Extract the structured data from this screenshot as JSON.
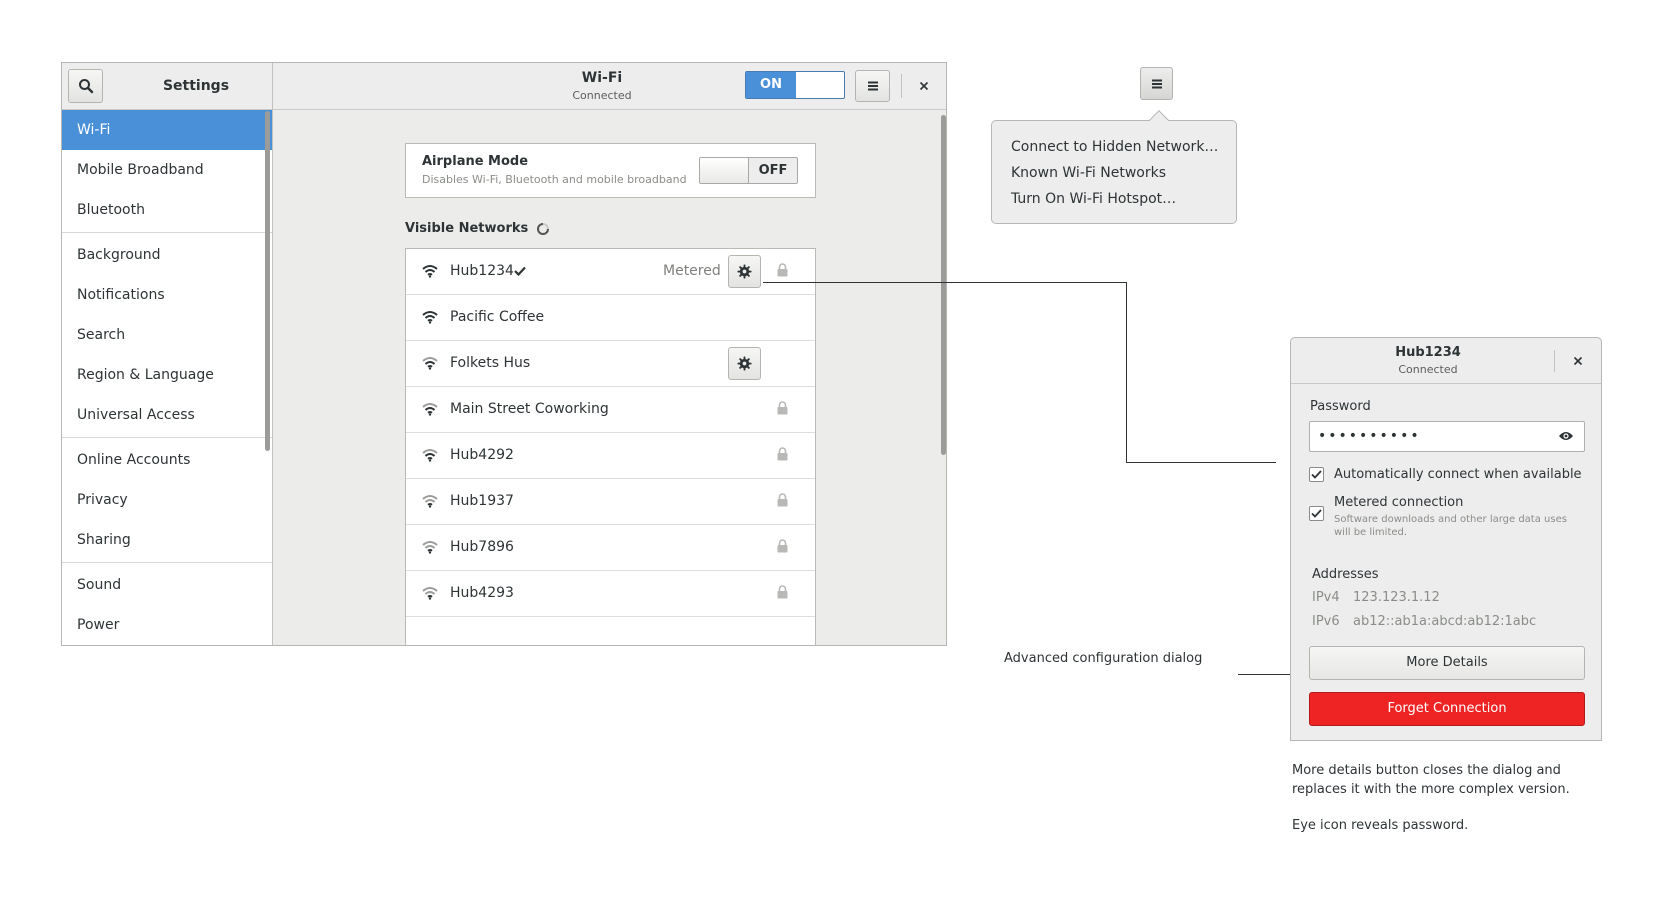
{
  "sidebar": {
    "title": "Settings",
    "items": [
      {
        "label": "Wi-Fi",
        "active": true
      },
      {
        "label": "Mobile Broadband"
      },
      {
        "label": "Bluetooth"
      },
      {
        "label": "Background"
      },
      {
        "label": "Notifications"
      },
      {
        "label": "Search"
      },
      {
        "label": "Region & Language"
      },
      {
        "label": "Universal Access"
      },
      {
        "label": "Online Accounts"
      },
      {
        "label": "Privacy"
      },
      {
        "label": "Sharing"
      },
      {
        "label": "Sound"
      },
      {
        "label": "Power"
      }
    ]
  },
  "header": {
    "title": "Wi-Fi",
    "subtitle": "Connected",
    "wifi_switch": "ON"
  },
  "airplane": {
    "title": "Airplane Mode",
    "subtitle": "Disables Wi-Fi, Bluetooth and mobile broadband",
    "switch": "OFF"
  },
  "visible_networks": {
    "title": "Visible Networks",
    "networks": [
      {
        "name": "Hub1234",
        "connected": true,
        "metered": "Metered",
        "settings": true,
        "locked": true
      },
      {
        "name": "Pacific Coffee"
      },
      {
        "name": "Folkets Hus",
        "settings": true
      },
      {
        "name": "Main Street Coworking",
        "locked": true
      },
      {
        "name": "Hub4292",
        "locked": true
      },
      {
        "name": "Hub1937",
        "locked": true
      },
      {
        "name": "Hub7896",
        "locked": true
      },
      {
        "name": "Hub4293",
        "locked": true
      }
    ]
  },
  "popover_menu": {
    "items": [
      "Connect to Hidden Network…",
      "Known Wi-Fi Networks",
      "Turn On Wi-Fi Hotspot…"
    ]
  },
  "dialog": {
    "title": "Hub1234",
    "subtitle": "Connected",
    "password_label": "Password",
    "password_value": "••••••••••",
    "auto_connect": "Automatically connect when available",
    "metered": "Metered connection",
    "metered_sub": "Software downloads and other large data uses will be limited.",
    "addresses_title": "Addresses",
    "ipv4_label": "IPv4",
    "ipv4_value": "123.123.1.12",
    "ipv6_label": "IPv6",
    "ipv6_value": "ab12::ab1a:abcd:ab12:1abc",
    "more_details": "More Details",
    "forget": "Forget Connection"
  },
  "annotations": {
    "advanced": "Advanced configuration dialog",
    "more_details_note": "More details button closes the dialog and replaces it with the more complex version.",
    "eye_note": "Eye icon reveals password."
  },
  "colors": {
    "accent": "#4a90d9",
    "destructive": "#ee2424"
  }
}
